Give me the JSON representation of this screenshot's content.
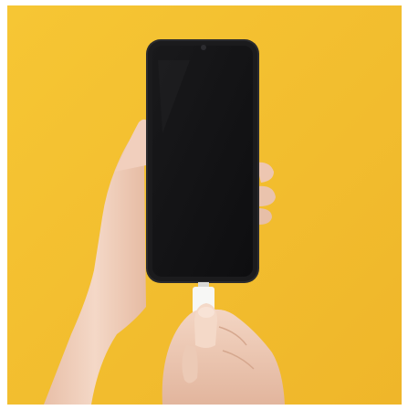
{
  "image": {
    "subject": "phone-charging",
    "colors": {
      "background": "#f4be2e",
      "phone_body": "#1b1b1d",
      "phone_screen": "#121214",
      "skin": "#f1d2c0",
      "skin_shadow": "#d9ad95",
      "cable": "#f7f7f5"
    }
  }
}
